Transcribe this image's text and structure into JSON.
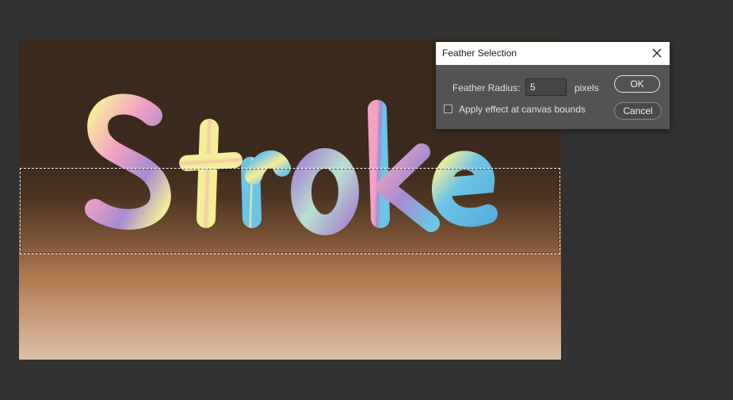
{
  "canvas": {
    "text": "Stroke"
  },
  "dialog": {
    "title": "Feather Selection",
    "feather_radius_label": "Feather Radius:",
    "feather_radius_value": "5",
    "unit_label": "pixels",
    "canvas_bounds_label": "Apply effect at canvas bounds",
    "canvas_bounds_checked": false,
    "ok_label": "OK",
    "cancel_label": "Cancel",
    "close_icon": "close-icon"
  },
  "colors": {
    "workspace_bg": "#323232",
    "dialog_bg": "#535353",
    "pink": "#f3a2c2",
    "yellow": "#f7ee9a",
    "blue": "#6cc4e6",
    "purple": "#a68bd1"
  }
}
